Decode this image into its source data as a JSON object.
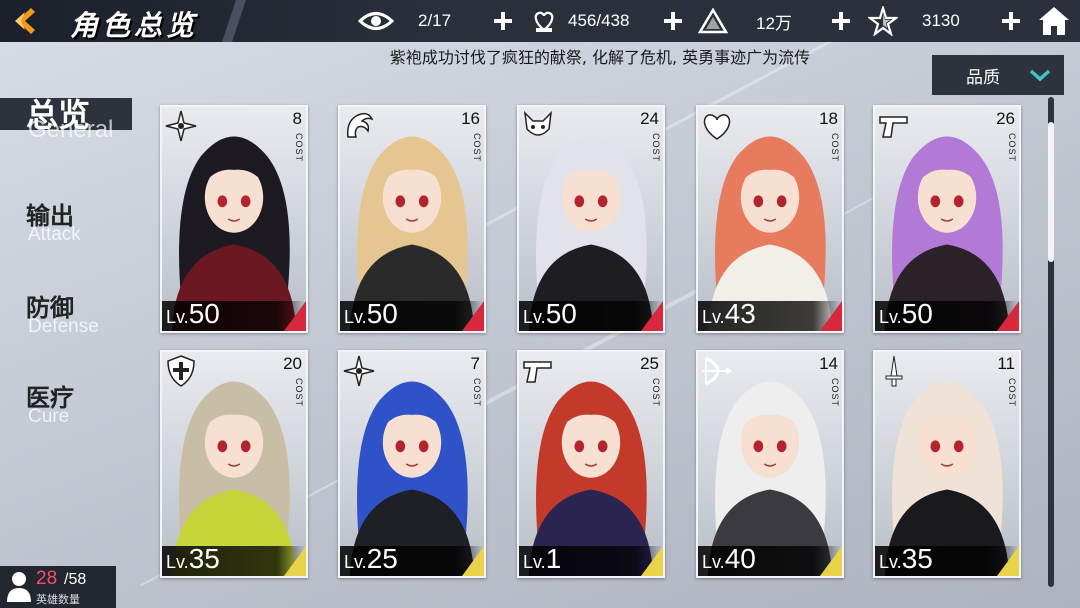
{
  "header": {
    "title": "角色总览",
    "resources": [
      {
        "icon": "eye-icon",
        "value": "2/17"
      },
      {
        "icon": "heart-hand-icon",
        "value": "456/438"
      },
      {
        "icon": "warning-triangle-icon",
        "value": "12万"
      },
      {
        "icon": "star-shard-icon",
        "value": "3130"
      }
    ]
  },
  "banner": {
    "text": "紫袍成功讨伐了疯狂的献祭, 化解了危机, 英勇事迹广为流传"
  },
  "filter": {
    "label": "品质"
  },
  "sidebar": {
    "items": [
      {
        "cn": "总览",
        "en": "General",
        "active": true
      },
      {
        "cn": "输出",
        "en": "Attack",
        "active": false
      },
      {
        "cn": "防御",
        "en": "Defense",
        "active": false
      },
      {
        "cn": "医疗",
        "en": "Cure",
        "active": false
      }
    ]
  },
  "cards": [
    {
      "cost": "8",
      "cost_label": "COST",
      "lv_prefix": "Lv.",
      "level": "50",
      "class_icon": "shuriken-icon",
      "accent": "#d8283e",
      "hair": "#1c1a20",
      "outfit": "#6b1822"
    },
    {
      "cost": "16",
      "cost_label": "COST",
      "lv_prefix": "Lv.",
      "level": "50",
      "class_icon": "dragon-icon",
      "accent": "#d8283e",
      "hair": "#e6c690",
      "outfit": "#2a2a2a"
    },
    {
      "cost": "24",
      "cost_label": "COST",
      "lv_prefix": "Lv.",
      "level": "50",
      "class_icon": "demon-mask-icon",
      "accent": "#d8283e",
      "hair": "#e2e2ea",
      "outfit": "#1d1d22"
    },
    {
      "cost": "18",
      "cost_label": "COST",
      "lv_prefix": "Lv.",
      "level": "43",
      "class_icon": "heart-icon",
      "accent": "#d8283e",
      "hair": "#e87a5e",
      "outfit": "#f2efe8"
    },
    {
      "cost": "26",
      "cost_label": "COST",
      "lv_prefix": "Lv.",
      "level": "50",
      "class_icon": "pistol-icon",
      "accent": "#d8283e",
      "hair": "#b27ad6",
      "outfit": "#2a2228"
    },
    {
      "cost": "20",
      "cost_label": "COST",
      "lv_prefix": "Lv.",
      "level": "35",
      "class_icon": "cross-shield-icon",
      "accent": "#e9d34a",
      "hair": "#c8bea6",
      "outfit": "#c6d63a"
    },
    {
      "cost": "7",
      "cost_label": "COST",
      "lv_prefix": "Lv.",
      "level": "25",
      "class_icon": "shuriken-icon",
      "accent": "#e9d34a",
      "hair": "#2f52c8",
      "outfit": "#1f2026"
    },
    {
      "cost": "25",
      "cost_label": "COST",
      "lv_prefix": "Lv.",
      "level": "1",
      "class_icon": "pistol-icon",
      "accent": "#e9d34a",
      "hair": "#c43a2a",
      "outfit": "#2c2450"
    },
    {
      "cost": "14",
      "cost_label": "COST",
      "lv_prefix": "Lv.",
      "level": "40",
      "class_icon": "bow-icon",
      "accent": "#e9d34a",
      "hair": "#eeeeee",
      "outfit": "#3a3a40"
    },
    {
      "cost": "11",
      "cost_label": "COST",
      "lv_prefix": "Lv.",
      "level": "35",
      "class_icon": "sword-icon",
      "accent": "#e9d34a",
      "hair": "#efe2d6",
      "outfit": "#1a1a1e"
    }
  ],
  "hero_count": {
    "current": "28",
    "max": "/58",
    "label": "英雄数量"
  }
}
